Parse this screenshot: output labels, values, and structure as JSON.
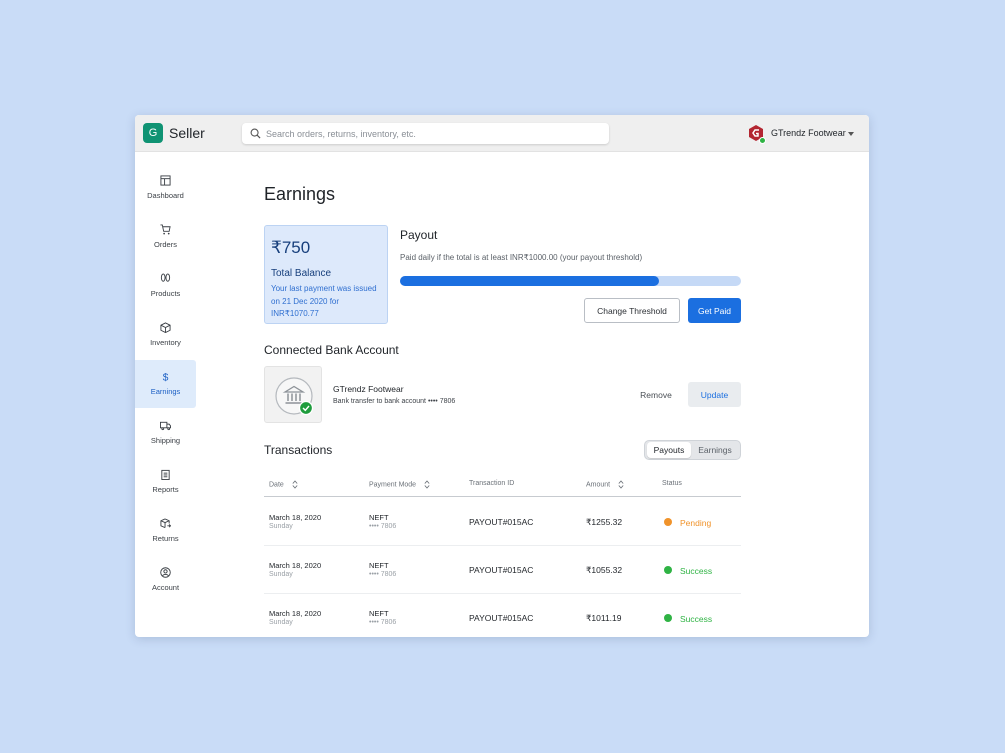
{
  "app": {
    "logo_letter": "G",
    "name": "Seller"
  },
  "search": {
    "placeholder": "Search orders, returns, inventory, etc."
  },
  "account": {
    "name": "GTrendz Footwear",
    "brand_logo_icon": "gtrendz-logo-icon",
    "online_color": "#2fb344"
  },
  "sidebar": {
    "items": [
      {
        "label": "Dashboard",
        "icon": "dashboard-icon",
        "active": false
      },
      {
        "label": "Orders",
        "icon": "cart-icon",
        "active": false
      },
      {
        "label": "Products",
        "icon": "shoe-prints-icon",
        "active": false
      },
      {
        "label": "Inventory",
        "icon": "box-icon",
        "active": false
      },
      {
        "label": "Earnings",
        "icon": "dollar-icon",
        "active": true
      },
      {
        "label": "Shipping",
        "icon": "truck-icon",
        "active": false
      },
      {
        "label": "Reports",
        "icon": "clipboard-icon",
        "active": false
      },
      {
        "label": "Returns",
        "icon": "box-return-icon",
        "active": false
      },
      {
        "label": "Account",
        "icon": "user-circle-icon",
        "active": false
      }
    ]
  },
  "page": {
    "title": "Earnings"
  },
  "balance": {
    "amount": "₹750",
    "label": "Total Balance",
    "note": "Your last payment was issued on 21 Dec 2020 for INR₹1070.77"
  },
  "payout": {
    "title": "Payout",
    "description": "Paid daily if the total is at least INR₹1000.00 (your payout threshold)",
    "progress_fraction": 0.76,
    "change_threshold_label": "Change Threshold",
    "get_paid_label": "Get Paid"
  },
  "bank": {
    "section_title": "Connected Bank Account",
    "icon": "bank-icon",
    "verified_icon": "check-circle-icon",
    "name": "GTrendz Footwear",
    "detail": "Bank transfer to bank account •••• 7806",
    "remove_label": "Remove",
    "update_label": "Update"
  },
  "transactions": {
    "section_title": "Transactions",
    "toggle": {
      "options": [
        "Payouts",
        "Earnings"
      ],
      "selected": "Payouts"
    },
    "columns": [
      "Date",
      "Payment Mode",
      "Transaction ID",
      "Amount",
      "Status"
    ],
    "rows": [
      {
        "date": "March 18, 2020",
        "day": "Sunday",
        "mode": "NEFT",
        "account": "•••• 7806",
        "txid": "PAYOUT#015AC",
        "amount": "₹1255.32",
        "status": "Pending",
        "status_color": "#f0932b"
      },
      {
        "date": "March 18, 2020",
        "day": "Sunday",
        "mode": "NEFT",
        "account": "•••• 7806",
        "txid": "PAYOUT#015AC",
        "amount": "₹1055.32",
        "status": "Success",
        "status_color": "#2fb344"
      },
      {
        "date": "March 18, 2020",
        "day": "Sunday",
        "mode": "NEFT",
        "account": "•••• 7806",
        "txid": "PAYOUT#015AC",
        "amount": "₹1011.19",
        "status": "Success",
        "status_color": "#2fb344"
      }
    ]
  },
  "colors": {
    "accent": "#1b6fe0",
    "brand": "#0f9373",
    "page_bg": "#c9dcf7",
    "active_nav_bg": "#deebfb"
  }
}
